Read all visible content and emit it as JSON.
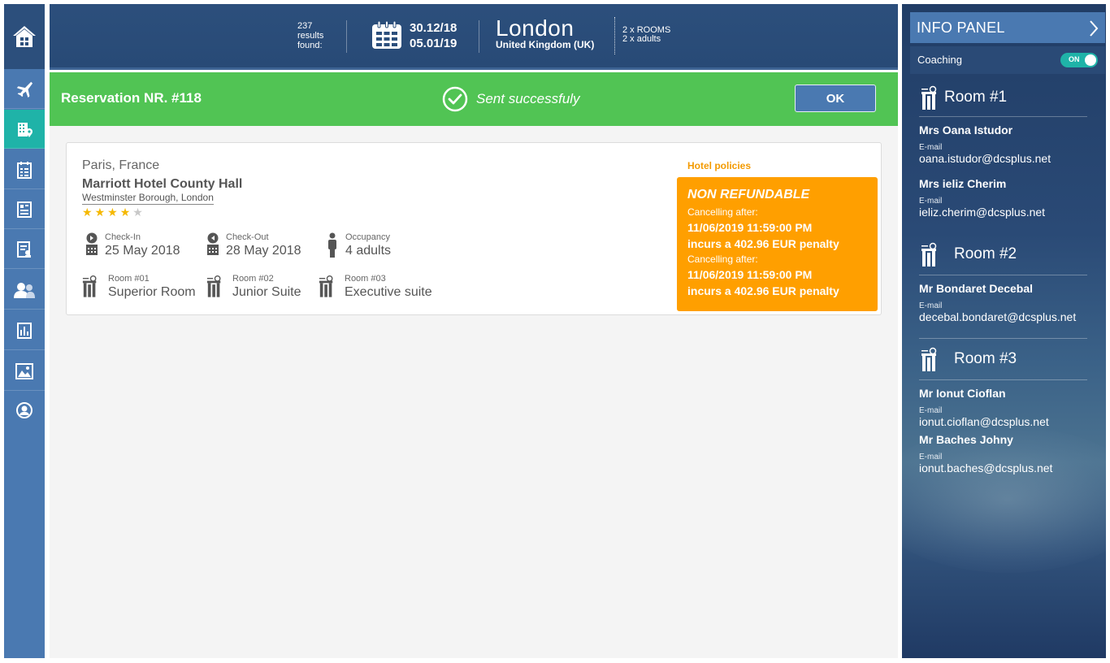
{
  "header": {
    "results_count": "237",
    "results_line1": "results",
    "results_line2": "found:",
    "date_from": "30.12/18",
    "date_to": "05.01/19",
    "city": "London",
    "country": "United Kingdom (UK)",
    "rooms": "2 x ROOMS",
    "adults": "2 x adults"
  },
  "success_bar": {
    "reservation": "Reservation NR. #118",
    "status": "Sent successfuly",
    "ok_label": "OK",
    "color": "#51c454"
  },
  "hotel": {
    "location": "Paris, France",
    "name": "Marriott Hotel County Hall",
    "address": "Westminster Borough, London",
    "stars_filled": 4,
    "stars_total": 5,
    "checkin_label": "Check-In",
    "checkin_value": "25 May 2018",
    "checkout_label": "Check-Out",
    "checkout_value": "28 May 2018",
    "occupancy_label": "Occupancy",
    "occupancy_value": "4 adults",
    "rooms": [
      {
        "label": "Room #01",
        "value": "Superior Room"
      },
      {
        "label": "Room #02",
        "value": "Junior Suite"
      },
      {
        "label": "Room #03",
        "value": "Executive suite"
      }
    ]
  },
  "policies": {
    "label": "Hotel policies",
    "title": "NON REFUNDABLE",
    "entries": [
      {
        "cancel_label": "Cancelling after:",
        "date": "11/06/2019 11:59:00 PM",
        "penalty": "incurs a 402.96 EUR penalty"
      },
      {
        "cancel_label": "Cancelling after:",
        "date": "11/06/2019 11:59:00 PM",
        "penalty": "incurs a 402.96 EUR penalty"
      }
    ],
    "color": "#ff9f00"
  },
  "info_panel": {
    "title": "INFO PANEL",
    "coaching_label": "Coaching",
    "toggle_label": "ON",
    "email_label": "E-mail",
    "rooms": [
      {
        "title": "Room #1",
        "guests": [
          {
            "name": "Mrs Oana Istudor",
            "email": "oana.istudor@dcsplus.net"
          },
          {
            "name": "Mrs ieliz Cherim",
            "email": "ieliz.cherim@dcsplus.net"
          }
        ]
      },
      {
        "title": "Room #2",
        "guests": [
          {
            "name": "Mr Bondaret Decebal",
            "email": "decebal.bondaret@dcsplus.net"
          }
        ]
      },
      {
        "title": "Room #3",
        "guests": [
          {
            "name": "Mr Ionut Cioflan",
            "email": "ionut.cioflan@dcsplus.net"
          },
          {
            "name": "Mr Baches Johny",
            "email": "ionut.baches@dcsplus.net"
          }
        ]
      }
    ]
  },
  "nav": {
    "items": [
      "home-icon",
      "flight-icon",
      "hotel-icon",
      "checklist-icon",
      "document-icon",
      "report-icon",
      "users-icon",
      "chart-icon",
      "image-icon",
      "profile-icon"
    ]
  }
}
